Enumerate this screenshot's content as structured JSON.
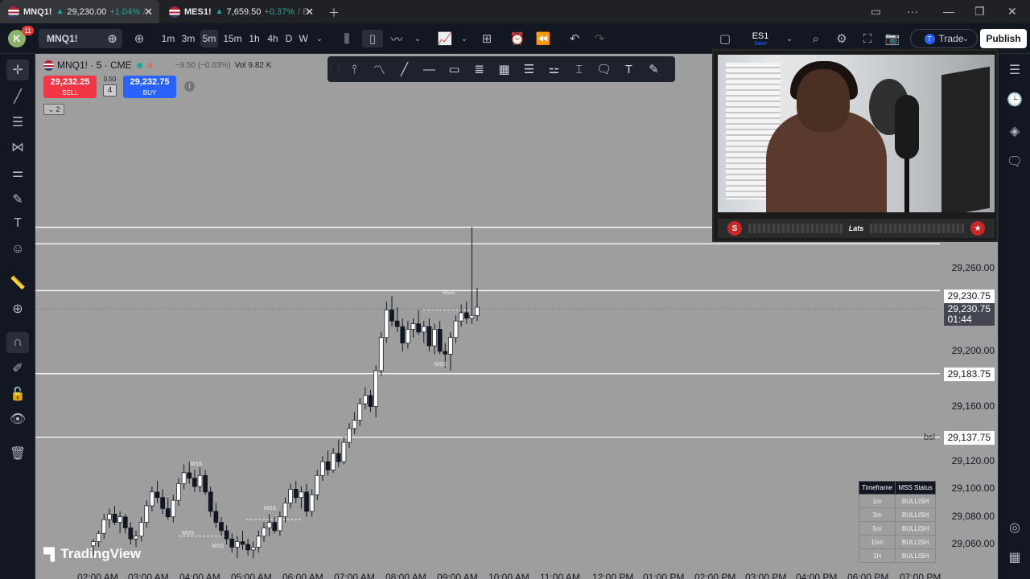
{
  "browser_tabs": [
    {
      "symbol": "MNQ1!",
      "price": "29,230.00",
      "change": "+1.04%",
      "more": "/"
    },
    {
      "symbol": "MES1!",
      "price": "7,659.50",
      "change": "+0.37%",
      "more": "/ E"
    }
  ],
  "toolbar": {
    "avatar_letter": "K",
    "notifications": "11",
    "symbol": "MNQ1!",
    "timeframes": [
      "1m",
      "3m",
      "5m",
      "15m",
      "1h",
      "4h",
      "D",
      "W"
    ],
    "selected_timeframe": "5m",
    "watch_symbol": "ES1",
    "watch_sub": "Save",
    "trade_label": "Trade",
    "publish_label": "Publish"
  },
  "legend": {
    "title": "MNQ1! · 5 · CME",
    "change": "−9.50 (−0.03%)",
    "vol_label": "Vol",
    "vol_value": "9.82 K"
  },
  "order_panel": {
    "sell_price": "29,232.25",
    "sell_label": "SELL",
    "spread": "0.50",
    "quantity": "4",
    "buy_price": "29,232.75",
    "buy_label": "BUY",
    "collapse_count": "2"
  },
  "price_axis": {
    "labels": [
      "29,260.00",
      "29,200.00",
      "29,160.00",
      "29,120.00",
      "29,100.00",
      "29,080.00",
      "29,060.00"
    ],
    "tags": [
      "29,230.75",
      "29,183.75",
      "29,137.75"
    ],
    "current_price": "29,230.75",
    "countdown": "01:44",
    "bsl_label": "bsl"
  },
  "time_axis": [
    "02:00 AM",
    "03:00 AM",
    "04:00 AM",
    "05:00 AM",
    "06:00 AM",
    "07:00 AM",
    "08:00 AM",
    "09:00 AM",
    "10:00 AM",
    "11:00 AM",
    "12:00 PM",
    "01:00 PM",
    "02:00 PM",
    "03:00 PM",
    "04:00 PM",
    "06:00 PM",
    "07:00 PM"
  ],
  "mss_label": "MSS",
  "mss_table": {
    "headers": [
      "Timeframe",
      "MSS Status"
    ],
    "rows": [
      {
        "tf": "1m",
        "status": "BULLISH"
      },
      {
        "tf": "3m",
        "status": "BULLISH"
      },
      {
        "tf": "5m",
        "status": "BULLISH"
      },
      {
        "tf": "15m",
        "status": "BULLISH"
      },
      {
        "tf": "1H",
        "status": "BULLISH"
      }
    ]
  },
  "brand": "TradingView",
  "webcam": {
    "name": "Lats",
    "left_badge": "S"
  },
  "colors": {
    "chart_bg": "#9e9e9e",
    "up": "#ffffff",
    "down": "#131722",
    "sell": "#f23645",
    "buy": "#2962ff",
    "accent": "#2962ff"
  },
  "chart_data": {
    "type": "candlestick",
    "title": "MNQ1! · 5 · CME",
    "ylim": [
      29050,
      29300
    ],
    "horizontal_levels": [
      29290,
      29278,
      29244,
      29183.75,
      29137.75
    ],
    "current_price": 29230.75,
    "candles": [
      {
        "o": 29059,
        "h": 29064,
        "l": 29052,
        "c": 29062
      },
      {
        "o": 29062,
        "h": 29070,
        "l": 29058,
        "c": 29068
      },
      {
        "o": 29068,
        "h": 29082,
        "l": 29064,
        "c": 29078
      },
      {
        "o": 29078,
        "h": 29086,
        "l": 29072,
        "c": 29082
      },
      {
        "o": 29082,
        "h": 29088,
        "l": 29074,
        "c": 29076
      },
      {
        "o": 29076,
        "h": 29084,
        "l": 29068,
        "c": 29080
      },
      {
        "o": 29080,
        "h": 29082,
        "l": 29068,
        "c": 29072
      },
      {
        "o": 29072,
        "h": 29076,
        "l": 29060,
        "c": 29064
      },
      {
        "o": 29064,
        "h": 29070,
        "l": 29058,
        "c": 29066
      },
      {
        "o": 29066,
        "h": 29080,
        "l": 29062,
        "c": 29076
      },
      {
        "o": 29076,
        "h": 29092,
        "l": 29072,
        "c": 29088
      },
      {
        "o": 29088,
        "h": 29102,
        "l": 29084,
        "c": 29098
      },
      {
        "o": 29098,
        "h": 29106,
        "l": 29090,
        "c": 29094
      },
      {
        "o": 29094,
        "h": 29100,
        "l": 29082,
        "c": 29086
      },
      {
        "o": 29086,
        "h": 29094,
        "l": 29078,
        "c": 29080
      },
      {
        "o": 29080,
        "h": 29096,
        "l": 29076,
        "c": 29092
      },
      {
        "o": 29092,
        "h": 29108,
        "l": 29088,
        "c": 29104
      },
      {
        "o": 29104,
        "h": 29118,
        "l": 29100,
        "c": 29112
      },
      {
        "o": 29112,
        "h": 29120,
        "l": 29104,
        "c": 29108
      },
      {
        "o": 29108,
        "h": 29114,
        "l": 29098,
        "c": 29102
      },
      {
        "o": 29102,
        "h": 29116,
        "l": 29098,
        "c": 29110
      },
      {
        "o": 29110,
        "h": 29114,
        "l": 29096,
        "c": 29098
      },
      {
        "o": 29098,
        "h": 29102,
        "l": 29080,
        "c": 29084
      },
      {
        "o": 29084,
        "h": 29090,
        "l": 29072,
        "c": 29076
      },
      {
        "o": 29076,
        "h": 29080,
        "l": 29066,
        "c": 29070
      },
      {
        "o": 29070,
        "h": 29074,
        "l": 29060,
        "c": 29064
      },
      {
        "o": 29064,
        "h": 29068,
        "l": 29054,
        "c": 29058
      },
      {
        "o": 29058,
        "h": 29066,
        "l": 29050,
        "c": 29062
      },
      {
        "o": 29062,
        "h": 29070,
        "l": 29056,
        "c": 29060
      },
      {
        "o": 29060,
        "h": 29064,
        "l": 29052,
        "c": 29056
      },
      {
        "o": 29056,
        "h": 29062,
        "l": 29050,
        "c": 29058
      },
      {
        "o": 29058,
        "h": 29070,
        "l": 29054,
        "c": 29066
      },
      {
        "o": 29066,
        "h": 29076,
        "l": 29062,
        "c": 29072
      },
      {
        "o": 29072,
        "h": 29082,
        "l": 29066,
        "c": 29076
      },
      {
        "o": 29076,
        "h": 29080,
        "l": 29068,
        "c": 29070
      },
      {
        "o": 29070,
        "h": 29084,
        "l": 29066,
        "c": 29080
      },
      {
        "o": 29080,
        "h": 29094,
        "l": 29076,
        "c": 29090
      },
      {
        "o": 29090,
        "h": 29104,
        "l": 29086,
        "c": 29100
      },
      {
        "o": 29100,
        "h": 29106,
        "l": 29090,
        "c": 29094
      },
      {
        "o": 29094,
        "h": 29102,
        "l": 29086,
        "c": 29098
      },
      {
        "o": 29098,
        "h": 29104,
        "l": 29080,
        "c": 29084
      },
      {
        "o": 29084,
        "h": 29100,
        "l": 29080,
        "c": 29096
      },
      {
        "o": 29096,
        "h": 29114,
        "l": 29092,
        "c": 29110
      },
      {
        "o": 29110,
        "h": 29124,
        "l": 29106,
        "c": 29120
      },
      {
        "o": 29120,
        "h": 29128,
        "l": 29110,
        "c": 29114
      },
      {
        "o": 29114,
        "h": 29130,
        "l": 29112,
        "c": 29126
      },
      {
        "o": 29126,
        "h": 29136,
        "l": 29116,
        "c": 29120
      },
      {
        "o": 29120,
        "h": 29138,
        "l": 29118,
        "c": 29134
      },
      {
        "o": 29134,
        "h": 29148,
        "l": 29130,
        "c": 29144
      },
      {
        "o": 29144,
        "h": 29156,
        "l": 29140,
        "c": 29150
      },
      {
        "o": 29150,
        "h": 29166,
        "l": 29146,
        "c": 29162
      },
      {
        "o": 29162,
        "h": 29174,
        "l": 29158,
        "c": 29168
      },
      {
        "o": 29168,
        "h": 29172,
        "l": 29156,
        "c": 29160
      },
      {
        "o": 29160,
        "h": 29190,
        "l": 29152,
        "c": 29186
      },
      {
        "o": 29186,
        "h": 29214,
        "l": 29182,
        "c": 29210
      },
      {
        "o": 29210,
        "h": 29236,
        "l": 29206,
        "c": 29230
      },
      {
        "o": 29230,
        "h": 29240,
        "l": 29218,
        "c": 29222
      },
      {
        "o": 29222,
        "h": 29232,
        "l": 29214,
        "c": 29218
      },
      {
        "o": 29218,
        "h": 29224,
        "l": 29200,
        "c": 29206
      },
      {
        "o": 29206,
        "h": 29222,
        "l": 29202,
        "c": 29216
      },
      {
        "o": 29216,
        "h": 29224,
        "l": 29210,
        "c": 29220
      },
      {
        "o": 29220,
        "h": 29230,
        "l": 29212,
        "c": 29214
      },
      {
        "o": 29214,
        "h": 29222,
        "l": 29206,
        "c": 29218
      },
      {
        "o": 29218,
        "h": 29224,
        "l": 29200,
        "c": 29204
      },
      {
        "o": 29204,
        "h": 29220,
        "l": 29198,
        "c": 29216
      },
      {
        "o": 29216,
        "h": 29222,
        "l": 29198,
        "c": 29200
      },
      {
        "o": 29200,
        "h": 29206,
        "l": 29188,
        "c": 29198
      },
      {
        "o": 29198,
        "h": 29214,
        "l": 29186,
        "c": 29210
      },
      {
        "o": 29210,
        "h": 29226,
        "l": 29206,
        "c": 29222
      },
      {
        "o": 29222,
        "h": 29234,
        "l": 29218,
        "c": 29228
      },
      {
        "o": 29228,
        "h": 29236,
        "l": 29220,
        "c": 29224
      },
      {
        "o": 29224,
        "h": 29290,
        "l": 29220,
        "c": 29226
      },
      {
        "o": 29226,
        "h": 29246,
        "l": 29222,
        "c": 29232
      }
    ]
  }
}
